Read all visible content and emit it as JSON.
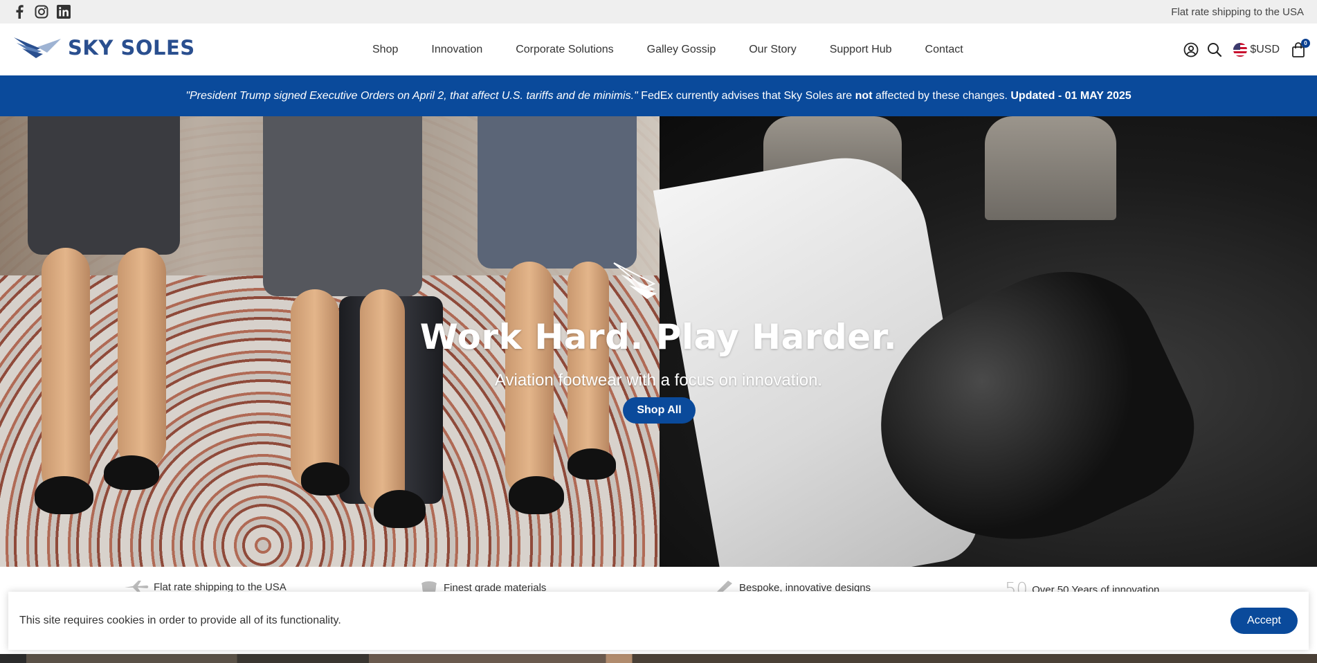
{
  "colors": {
    "brand_blue": "#0a4a9b",
    "logo_blue": "#2a4f8f",
    "topbar_bg": "#efefef"
  },
  "topbar": {
    "social_icons": [
      "facebook-icon",
      "instagram-icon",
      "linkedin-icon"
    ],
    "shipping_text": "Flat rate shipping to the USA"
  },
  "header": {
    "brand": "SKY SOLES",
    "nav": [
      "Shop",
      "Innovation",
      "Corporate Solutions",
      "Galley Gossip",
      "Our Story",
      "Support Hub",
      "Contact"
    ],
    "currency": "$USD",
    "cart_count": "0"
  },
  "announcement": {
    "quote": "\"President Trump signed Executive Orders on April 2, that affect U.S. tariffs and de minimis.\"",
    "text_before": " FedEx currently advises that Sky Soles are ",
    "emphasis": "not",
    "text_after": " affected by these changes. ",
    "updated": "Updated - 01 MAY 2025"
  },
  "hero": {
    "headline": "Work Hard. Play Harder.",
    "subheadline": "Aviation footwear with a focus on innovation.",
    "cta": "Shop All"
  },
  "features": [
    {
      "icon": "airplane-icon",
      "label": "Flat rate shipping to the USA"
    },
    {
      "icon": "leather-icon",
      "label": "Finest grade materials"
    },
    {
      "icon": "pencil-icon",
      "label": "Bespoke, innovative designs"
    },
    {
      "icon_text": "50",
      "label": "Over 50 Years of innovation"
    }
  ],
  "cookie": {
    "message": "This site requires cookies in order to provide all of its functionality.",
    "accept": "Accept"
  }
}
